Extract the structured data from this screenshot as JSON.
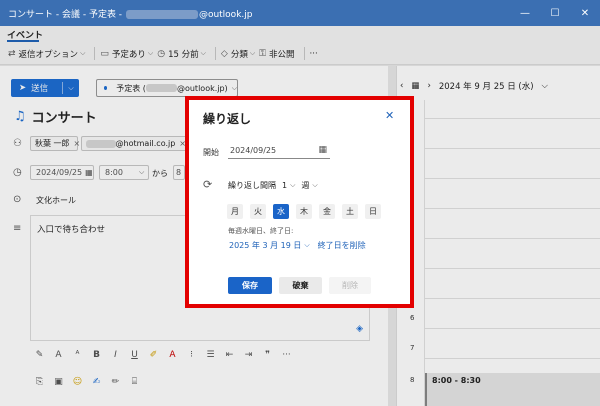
{
  "window": {
    "title_prefix": "コンサート - 会議 - 予定表 -",
    "title_suffix": "@outlook.jp",
    "controls": [
      "—",
      "☐",
      "✕"
    ]
  },
  "menu": {
    "tab": "イベント"
  },
  "toolbar": {
    "items": [
      {
        "icon": "send-options-icon",
        "glyph": "⇄",
        "label": "返信オプション",
        "chevron": true
      },
      {
        "icon": "busy-icon",
        "glyph": "▭",
        "label": "予定あり",
        "chevron": true
      },
      {
        "icon": "reminder-clock-icon",
        "glyph": "◷",
        "label": "15 分前",
        "chevron": true
      },
      {
        "icon": "category-tag-icon",
        "glyph": "◇",
        "label": "分類",
        "chevron": true
      },
      {
        "icon": "private-lock-icon",
        "glyph": "⚿",
        "label": "非公開",
        "chevron": false
      }
    ],
    "more": "···"
  },
  "compose": {
    "send_label": "送信",
    "from_prefix": "予定表 (",
    "from_suffix": "@outlook.jp)",
    "event_title": "コンサート",
    "attendee1": "秋葉 一郎",
    "attendee2_suffix": "@hotmail.co.jp",
    "start_date": "2024/09/25",
    "start_time": "8:00",
    "to_label": "から",
    "end_partial": "8",
    "location": "文化ホール",
    "body_text": "入口で待ち合わせ"
  },
  "calendar": {
    "date_header": "2024 年 9 月 25 日 (水)",
    "hours": [
      "6",
      "7",
      "8"
    ],
    "event_time": "8:00 - 8:30"
  },
  "dialog": {
    "title": "繰り返し",
    "start_label": "開始",
    "start_date": "2024/09/25",
    "interval_label": "繰り返し間隔",
    "interval_value": "1",
    "unit": "週",
    "days": [
      "月",
      "火",
      "水",
      "木",
      "金",
      "土",
      "日"
    ],
    "selected_day": "水",
    "summary": "毎週水曜日、終了日:",
    "end_date": "2025 年 3 月 19 日",
    "remove_end": "終了日を削除",
    "save": "保存",
    "discard": "破棄",
    "delete": "削除"
  },
  "colors": {
    "accent": "#1a64c8",
    "highlight_frame": "#e30000",
    "titlebar": "#3b6fb2"
  }
}
